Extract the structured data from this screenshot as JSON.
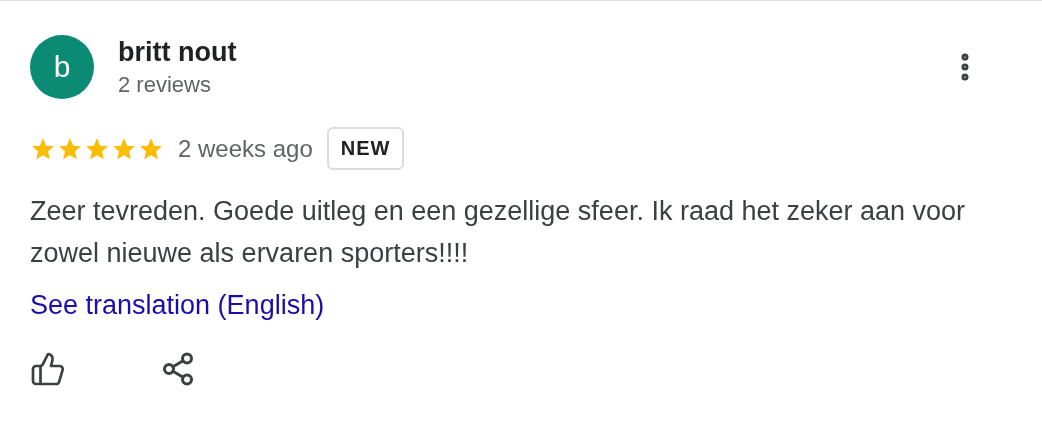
{
  "review": {
    "avatar_letter": "b",
    "author": "britt nout",
    "author_meta": "2 reviews",
    "stars": 5,
    "time": "2 weeks ago",
    "badge": "NEW",
    "text": "Zeer tevreden. Goede uitleg en een gezellige sfeer. Ik raad het zeker aan voor zowel nieuwe als ervaren sporters!!!!",
    "translation_link": "See translation (English)"
  }
}
